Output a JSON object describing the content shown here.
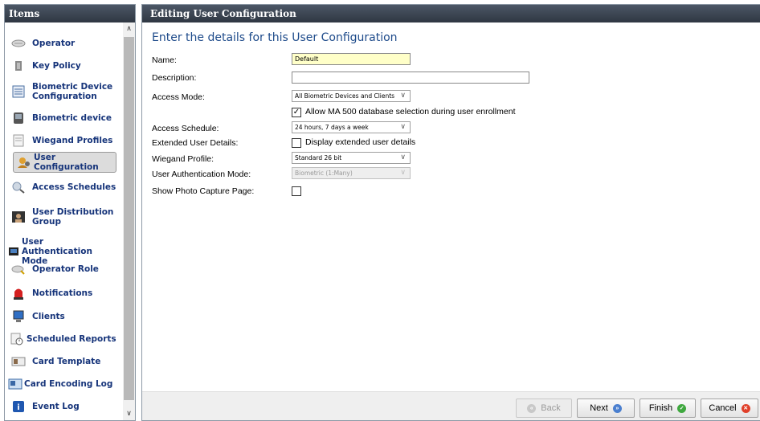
{
  "sidebar": {
    "header": "Items",
    "items": [
      {
        "label": "Operator",
        "icon": "operator-icon"
      },
      {
        "label": "Key Policy",
        "icon": "key-policy-icon"
      },
      {
        "label": "Biometric Device Configuration",
        "icon": "biometric-config-icon"
      },
      {
        "label": "Biometric device",
        "icon": "biometric-device-icon"
      },
      {
        "label": "Wiegand Profiles",
        "icon": "wiegand-icon"
      },
      {
        "label": "User Configuration",
        "icon": "user-config-icon"
      },
      {
        "label": "Access Schedules",
        "icon": "access-schedule-icon"
      },
      {
        "label": "User Distribution Group",
        "icon": "user-distribution-icon"
      },
      {
        "label": "User Authentication Mode",
        "icon": "user-auth-icon"
      },
      {
        "label": "Operator Role",
        "icon": "operator-role-icon"
      },
      {
        "label": "Notifications",
        "icon": "notifications-icon"
      },
      {
        "label": "Clients",
        "icon": "clients-icon"
      },
      {
        "label": "Scheduled Reports",
        "icon": "scheduled-reports-icon"
      },
      {
        "label": "Card Template",
        "icon": "card-template-icon"
      },
      {
        "label": "Card Encoding Log",
        "icon": "card-encoding-icon"
      },
      {
        "label": "Event Log",
        "icon": "event-log-icon"
      }
    ]
  },
  "editor": {
    "header": "Editing User Configuration",
    "title": "Enter the details for this User Configuration",
    "labels": {
      "name": "Name:",
      "description": "Description:",
      "access_mode": "Access Mode:",
      "access_schedule": "Access Schedule:",
      "extended": "Extended User Details:",
      "wiegand": "Wiegand Profile:",
      "auth_mode": "User Authentication Mode:",
      "photo": "Show Photo Capture Page:"
    },
    "values": {
      "name": "Default",
      "description": "",
      "access_mode": "All Biometric Devices and Clients",
      "ma500_label": "Allow MA 500 database selection during user enrollment",
      "access_schedule": "24 hours, 7 days a week",
      "extended_label": "Display extended user details",
      "wiegand": "Standard 26 bit",
      "auth_mode": "Biometric (1:Many)"
    }
  },
  "footer": {
    "back": "Back",
    "next": "Next",
    "finish": "Finish",
    "cancel": "Cancel"
  }
}
